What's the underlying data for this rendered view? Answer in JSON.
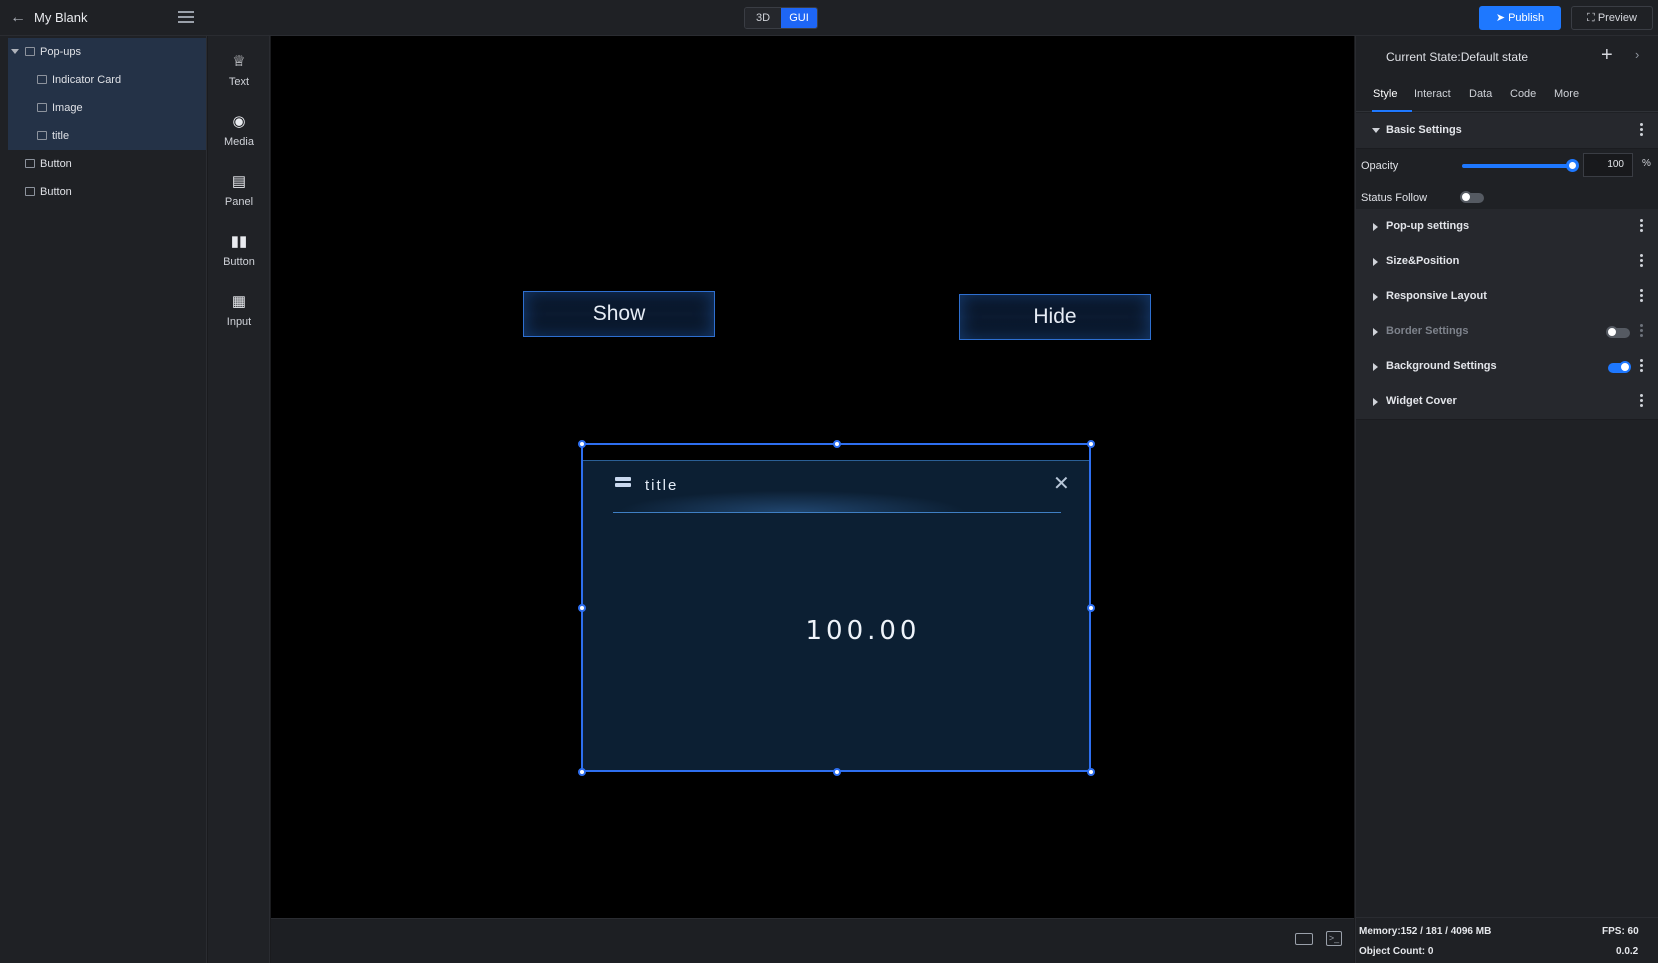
{
  "header": {
    "back_icon": "arrow-left-icon",
    "title": "My Blank",
    "menu_icon": "hamburger-icon",
    "modes": [
      "3D",
      "GUI"
    ],
    "active_mode": "GUI",
    "publish": "Publish",
    "preview": "Preview"
  },
  "tree": [
    {
      "label": "Pop-ups",
      "icon": "widget-icon",
      "selected": true,
      "level": 0
    },
    {
      "label": "Indicator Card",
      "icon": "indicator-icon",
      "selected": true,
      "level": 1
    },
    {
      "label": "Image",
      "icon": "image-icon",
      "selected": true,
      "level": 1
    },
    {
      "label": "title",
      "icon": "text-icon",
      "selected": true,
      "level": 1
    },
    {
      "label": "Button",
      "icon": "button-icon",
      "selected": false,
      "level": 0
    },
    {
      "label": "Button",
      "icon": "button-icon",
      "selected": false,
      "level": 0
    }
  ],
  "tools": [
    {
      "label": "Text",
      "icon": "crown-icon"
    },
    {
      "label": "Media",
      "icon": "camera-icon"
    },
    {
      "label": "Panel",
      "icon": "panel-icon"
    },
    {
      "label": "Button",
      "icon": "bar-chart-icon"
    },
    {
      "label": "Input",
      "icon": "map-icon"
    }
  ],
  "canvas": {
    "show_button": "Show",
    "hide_button": "Hide",
    "popup": {
      "title": "title",
      "value": "100.00",
      "close_icon": "close-icon"
    }
  },
  "right_panel": {
    "state": "Current State:Default state",
    "tabs": [
      "Style",
      "Interact",
      "Data",
      "Code",
      "More"
    ],
    "active_tab": "Style",
    "basic_settings": "Basic Settings",
    "opacity_label": "Opacity",
    "opacity_value": "100",
    "opacity_unit": "%",
    "opacity_level": 1.0,
    "status_follow_label": "Status Follow",
    "status_follow_on": false,
    "sections": [
      {
        "label": "Pop-up settings",
        "dim": false,
        "toggle": null
      },
      {
        "label": "Size&Position",
        "dim": false,
        "toggle": null
      },
      {
        "label": "Responsive Layout",
        "dim": false,
        "toggle": null
      },
      {
        "label": "Border Settings",
        "dim": true,
        "toggle": false
      },
      {
        "label": "Background Settings",
        "dim": false,
        "toggle": true
      },
      {
        "label": "Widget Cover",
        "dim": false,
        "toggle": null
      }
    ]
  },
  "status": {
    "memory": "Memory:152 / 181 / 4096 MB",
    "fps": "FPS: 60",
    "objects": "Object Count: 0",
    "version": "0.0.2"
  },
  "colors": {
    "accent": "#1e78ff",
    "canvas_bg": "#000000",
    "panel_bg": "#1f2125",
    "popup_bg": "#0c1f33"
  }
}
